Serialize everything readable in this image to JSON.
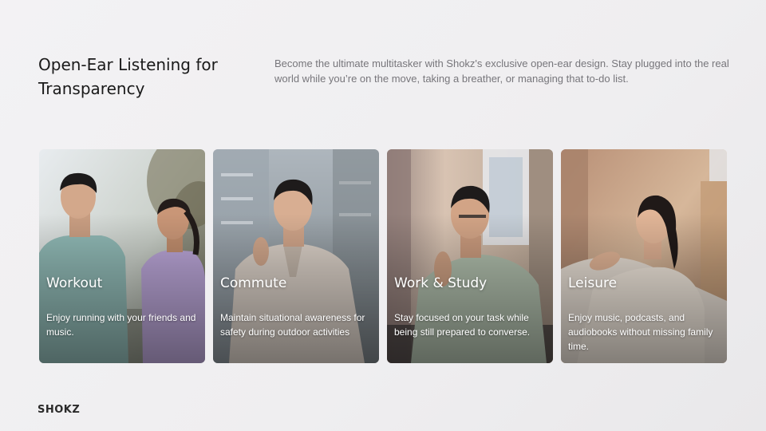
{
  "header": {
    "title": "Open-Ear Listening for Transparency",
    "intro": "Become the ultimate multitasker with Shokz's exclusive open-ear design. Stay plugged into the real world while you’re on the move, taking a breather, or managing that to-do list."
  },
  "cards": [
    {
      "title": "Workout",
      "description": "Enjoy running with your friends and music."
    },
    {
      "title": "Commute",
      "description": "Maintain situational awareness for safety during outdoor activities"
    },
    {
      "title": "Work & Study",
      "description": "Stay focused on your task while being still prepared to converse."
    },
    {
      "title": "Leisure",
      "description": "Enjoy music, podcasts, and audiobooks without missing family time."
    }
  ],
  "brand": {
    "logo": "SHOKZ"
  },
  "colors": {
    "heading": "#1a1a1a",
    "body_text": "#77767b",
    "card_text": "#ffffff"
  }
}
